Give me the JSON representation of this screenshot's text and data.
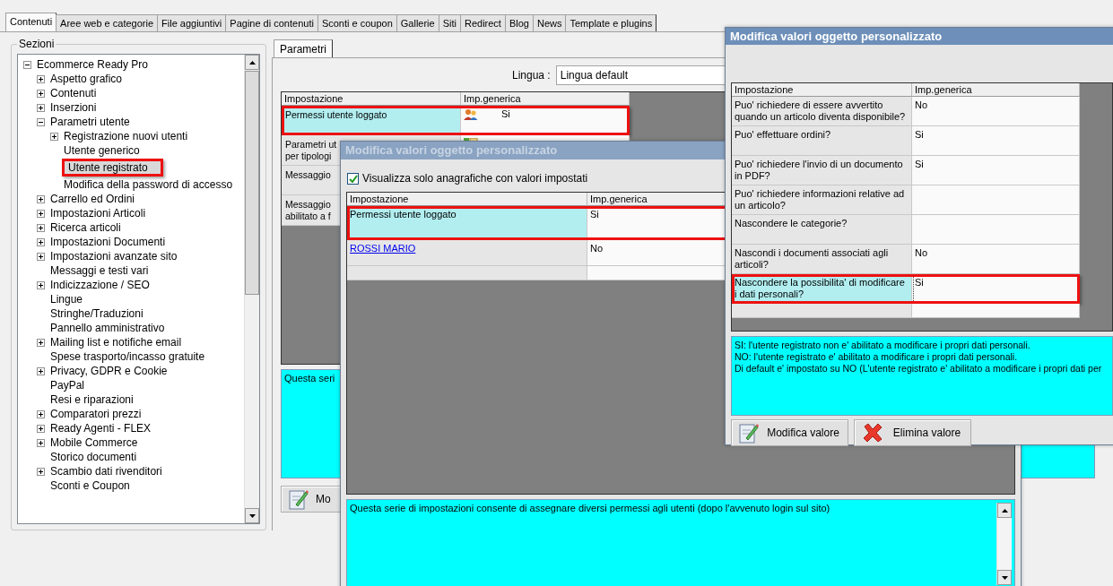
{
  "tabs": [
    {
      "label": "Contenuti",
      "selected": true
    },
    {
      "label": "Aree web e categorie",
      "selected": false
    },
    {
      "label": "File aggiuntivi",
      "selected": false
    },
    {
      "label": "Pagine di contenuti",
      "selected": false
    },
    {
      "label": "Sconti e coupon",
      "selected": false
    },
    {
      "label": "Gallerie",
      "selected": false
    },
    {
      "label": "Siti",
      "selected": false
    },
    {
      "label": "Redirect",
      "selected": false
    },
    {
      "label": "Blog",
      "selected": false
    },
    {
      "label": "News",
      "selected": false
    },
    {
      "label": "Template e plugins",
      "selected": false
    }
  ],
  "sections": {
    "title": "Sezioni",
    "tree": [
      {
        "label": "Ecommerce Ready Pro",
        "kind": "folder",
        "expanded": true,
        "selected": false,
        "highlighted": false,
        "children": [
          {
            "label": "Aspetto grafico",
            "kind": "folder",
            "expanded": false,
            "selected": false,
            "highlighted": false
          },
          {
            "label": "Contenuti",
            "kind": "folder",
            "expanded": false,
            "selected": false,
            "highlighted": false
          },
          {
            "label": "Inserzioni",
            "kind": "folder",
            "expanded": false,
            "selected": false,
            "highlighted": false
          },
          {
            "label": "Parametri utente",
            "kind": "folder",
            "expanded": true,
            "selected": false,
            "highlighted": false,
            "children": [
              {
                "label": "Registrazione nuovi utenti",
                "kind": "folder",
                "expanded": false,
                "selected": false,
                "highlighted": false
              },
              {
                "label": "Utente generico",
                "kind": "leaf",
                "selected": false,
                "highlighted": false
              },
              {
                "label": "Utente registrato",
                "kind": "leaf",
                "selected": true,
                "highlighted": true
              },
              {
                "label": "Modifica della password di accesso",
                "kind": "leaf",
                "selected": false,
                "highlighted": false
              }
            ]
          },
          {
            "label": "Carrello ed Ordini",
            "kind": "folder",
            "expanded": false,
            "selected": false,
            "highlighted": false
          },
          {
            "label": "Impostazioni Articoli",
            "kind": "folder",
            "expanded": false,
            "selected": false,
            "highlighted": false
          },
          {
            "label": "Ricerca articoli",
            "kind": "folder",
            "expanded": false,
            "selected": false,
            "highlighted": false
          },
          {
            "label": "Impostazioni Documenti",
            "kind": "folder",
            "expanded": false,
            "selected": false,
            "highlighted": false
          },
          {
            "label": "Impostazioni avanzate sito",
            "kind": "folder",
            "expanded": false,
            "selected": false,
            "highlighted": false
          },
          {
            "label": "Messaggi e testi vari",
            "kind": "leaf",
            "selected": false,
            "highlighted": false
          },
          {
            "label": "Indicizzazione / SEO",
            "kind": "folder",
            "expanded": false,
            "selected": false,
            "highlighted": false
          },
          {
            "label": "Lingue",
            "kind": "leaf",
            "selected": false,
            "highlighted": false
          },
          {
            "label": "Stringhe/Traduzioni",
            "kind": "leaf",
            "selected": false,
            "highlighted": false
          },
          {
            "label": "Pannello amministrativo",
            "kind": "leaf",
            "selected": false,
            "highlighted": false
          },
          {
            "label": "Mailing list e notifiche email",
            "kind": "folder",
            "expanded": false,
            "selected": false,
            "highlighted": false
          },
          {
            "label": "Spese trasporto/incasso gratuite",
            "kind": "leaf",
            "selected": false,
            "highlighted": false
          },
          {
            "label": "Privacy, GDPR e Cookie",
            "kind": "folder",
            "expanded": false,
            "selected": false,
            "highlighted": false
          },
          {
            "label": "PayPal",
            "kind": "leaf",
            "selected": false,
            "highlighted": false
          },
          {
            "label": "Resi e riparazioni",
            "kind": "leaf",
            "selected": false,
            "highlighted": false
          },
          {
            "label": "Comparatori prezzi",
            "kind": "folder",
            "expanded": false,
            "selected": false,
            "highlighted": false
          },
          {
            "label": "Ready Agenti - FLEX",
            "kind": "folder",
            "expanded": false,
            "selected": false,
            "highlighted": false
          },
          {
            "label": "Mobile Commerce",
            "kind": "folder",
            "expanded": false,
            "selected": false,
            "highlighted": false
          },
          {
            "label": "Storico documenti",
            "kind": "leaf",
            "selected": false,
            "highlighted": false
          },
          {
            "label": "Scambio dati rivenditori",
            "kind": "folder",
            "expanded": false,
            "selected": false,
            "highlighted": false
          },
          {
            "label": "Sconti e Coupon",
            "kind": "leaf",
            "selected": false,
            "highlighted": false
          }
        ]
      }
    ]
  },
  "main": {
    "tabs": [
      {
        "label": "Parametri",
        "selected": true
      }
    ],
    "language": {
      "label": "Lingua :",
      "value": "Lingua default"
    },
    "table": {
      "columns": [
        "Impostazione",
        "Imp.generica"
      ],
      "rows": [
        {
          "setting": [
            "Permessi utente loggato"
          ],
          "value": "Si",
          "kind": "permissions",
          "selected": true,
          "highlighted": true
        },
        {
          "setting": [
            "Parametri ut",
            "per tipologi"
          ],
          "kind": "parameters",
          "selected": false,
          "highlighted": false
        },
        {
          "setting": [
            "Messaggio"
          ],
          "kind": "plain",
          "selected": false,
          "highlighted": false
        },
        {
          "setting": [
            "Messaggio",
            "abilitato a f"
          ],
          "kind": "plain",
          "selected": false,
          "highlighted": false
        }
      ]
    },
    "description": "Questa seri",
    "button": "Mo"
  },
  "dialogs": [
    {
      "title": "Modifica valori oggetto personalizzato",
      "active": false,
      "filter": {
        "label": "Visualizza solo anagrafiche con valori impostati",
        "checked": true
      },
      "table": {
        "columns": [
          "Impostazione",
          "Imp.generica"
        ],
        "rows": [
          {
            "setting": "Permessi utente loggato",
            "value": "Si",
            "kind": "plain",
            "selected": true,
            "highlighted": true
          },
          {
            "setting": "ROSSI MARIO",
            "value": "No",
            "kind": "link",
            "selected": false,
            "highlighted": false
          },
          {
            "kind": "empty",
            "selected": false,
            "highlighted": false
          }
        ]
      },
      "description": [
        "Questa serie di impostazioni consente di assegnare diversi permessi agli utenti (dopo l'avvenuto login sul sito)"
      ]
    },
    {
      "title": "Modifica valori oggetto personalizzato",
      "active": true,
      "table": {
        "columns": [
          "Impostazione",
          "Imp.generica"
        ],
        "rows": [
          {
            "setting": "Puo' richiedere di essere avvertito quando un articolo diventa disponibile?",
            "value": "No",
            "kind": "plain",
            "selected": false,
            "highlighted": false
          },
          {
            "setting": "Puo' effettuare ordini?",
            "value": "Si",
            "kind": "plain",
            "selected": false,
            "highlighted": false
          },
          {
            "setting": "Puo' richiedere l'invio di un documento in PDF?",
            "value": "Si",
            "kind": "plain",
            "selected": false,
            "highlighted": false
          },
          {
            "setting": "Puo' richiedere informazioni relative ad un articolo?",
            "kind": "plain",
            "selected": false,
            "highlighted": false
          },
          {
            "setting": "Nascondere le categorie?",
            "kind": "plain",
            "selected": false,
            "highlighted": false
          },
          {
            "setting": "Nascondi i documenti associati agli articoli?",
            "value": "No",
            "kind": "plain",
            "selected": false,
            "highlighted": false
          },
          {
            "setting": "Nascondere la possibilita' di modificare i dati personali?",
            "value": "Si",
            "kind": "plain",
            "selected": true,
            "highlighted": true
          },
          {
            "kind": "empty",
            "selected": false,
            "highlighted": false
          }
        ]
      },
      "description": [
        "SI: l'utente registrato non e' abilitato a modificare i propri dati personali.",
        "NO: l'utente registrato e' abilitato a modificare i propri dati personali.",
        "Di default e' impostato su NO (L'utente registrato e' abilitato a modificare i propri dati per"
      ],
      "buttons": [
        {
          "label": "Modifica valore",
          "kind": "edit"
        },
        {
          "label": "Elimina valore",
          "kind": "delete"
        }
      ]
    }
  ]
}
